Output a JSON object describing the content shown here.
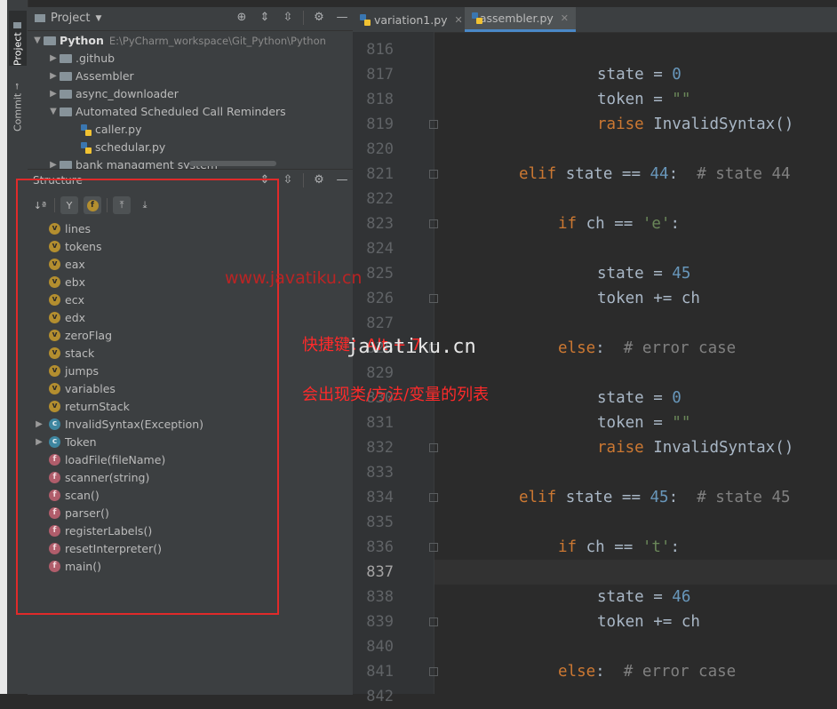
{
  "tool_strip": {
    "project_tab": "Project",
    "commit_tab": "Commit"
  },
  "project_panel": {
    "title": "Project",
    "root": {
      "name": "Python",
      "path": "E:\\PyCharm_workspace\\Git_Python\\Python"
    },
    "items": [
      {
        "name": ".github"
      },
      {
        "name": "Assembler"
      },
      {
        "name": "async_downloader"
      },
      {
        "name": "Automated Scheduled Call Reminders"
      },
      {
        "name": "caller.py"
      },
      {
        "name": "schedular.py"
      },
      {
        "name": "bank managment system"
      }
    ]
  },
  "structure_panel": {
    "title": "Structure",
    "items": [
      {
        "kind": "v",
        "label": "lines"
      },
      {
        "kind": "v",
        "label": "tokens"
      },
      {
        "kind": "v",
        "label": "eax"
      },
      {
        "kind": "v",
        "label": "ebx"
      },
      {
        "kind": "v",
        "label": "ecx"
      },
      {
        "kind": "v",
        "label": "edx"
      },
      {
        "kind": "v",
        "label": "zeroFlag"
      },
      {
        "kind": "v",
        "label": "stack"
      },
      {
        "kind": "v",
        "label": "jumps"
      },
      {
        "kind": "v",
        "label": "variables"
      },
      {
        "kind": "v",
        "label": "returnStack"
      },
      {
        "kind": "c",
        "label": "InvalidSyntax(Exception)"
      },
      {
        "kind": "c",
        "label": "Token"
      },
      {
        "kind": "f",
        "label": "loadFile(fileName)"
      },
      {
        "kind": "f",
        "label": "scanner(string)"
      },
      {
        "kind": "f",
        "label": "scan()"
      },
      {
        "kind": "f",
        "label": "parser()"
      },
      {
        "kind": "f",
        "label": "registerLabels()"
      },
      {
        "kind": "f",
        "label": "resetInterpreter()"
      },
      {
        "kind": "f",
        "label": "main()"
      }
    ],
    "badge_letters": {
      "v": "v",
      "c": "c",
      "f": "f"
    }
  },
  "editor": {
    "tabs": [
      {
        "label": "variation1.py"
      },
      {
        "label": "assembler.py"
      }
    ],
    "line_numbers": [
      "816",
      "817",
      "818",
      "819",
      "820",
      "821",
      "822",
      "823",
      "824",
      "825",
      "826",
      "827",
      "828",
      "829",
      "830",
      "831",
      "832",
      "833",
      "834",
      "835",
      "836",
      "837",
      "838",
      "839",
      "840",
      "841",
      "842"
    ],
    "current_line": "837",
    "code": {
      "l817": {
        "a": "state",
        "b": " = ",
        "c": "0"
      },
      "l818": {
        "a": "token",
        "b": " = ",
        "c": "\"\""
      },
      "l819": {
        "a": "raise",
        "b": " InvalidSyntax()"
      },
      "l821": {
        "a": "elif",
        "b": " state == ",
        "c": "44",
        "d": ":  ",
        "e": "# state 44"
      },
      "l823": {
        "a": "if",
        "b": " ch == ",
        "c": "'e'",
        "d": ":"
      },
      "l825": {
        "a": "state",
        "b": " = ",
        "c": "45"
      },
      "l826": {
        "a": "token += ch"
      },
      "l828": {
        "a": "else",
        "b": ":  ",
        "c": "# error case"
      },
      "l830": {
        "a": "state",
        "b": " = ",
        "c": "0"
      },
      "l831": {
        "a": "token",
        "b": " = ",
        "c": "\"\""
      },
      "l832": {
        "a": "raise",
        "b": " InvalidSyntax()"
      },
      "l834": {
        "a": "elif",
        "b": " state == ",
        "c": "45",
        "d": ":  ",
        "e": "# state 45"
      },
      "l836": {
        "a": "if",
        "b": " ch == ",
        "c": "'t'",
        "d": ":"
      },
      "l838": {
        "a": "state",
        "b": " = ",
        "c": "46"
      },
      "l839": {
        "a": "token += ch"
      },
      "l841": {
        "a": "else",
        "b": ":  ",
        "c": "# error case"
      }
    }
  },
  "annotations": {
    "shortcut": "快捷键：Alt + 7",
    "description": "会出现类/方法/变量的列表",
    "watermark_red": "www.javatiku.cn",
    "watermark_white": "javatiku.cn"
  },
  "colors": {
    "accent_red": "#e02a2a",
    "keyword": "#cc7832",
    "number": "#6897bb",
    "string": "#6a8759",
    "comment": "#808080"
  }
}
